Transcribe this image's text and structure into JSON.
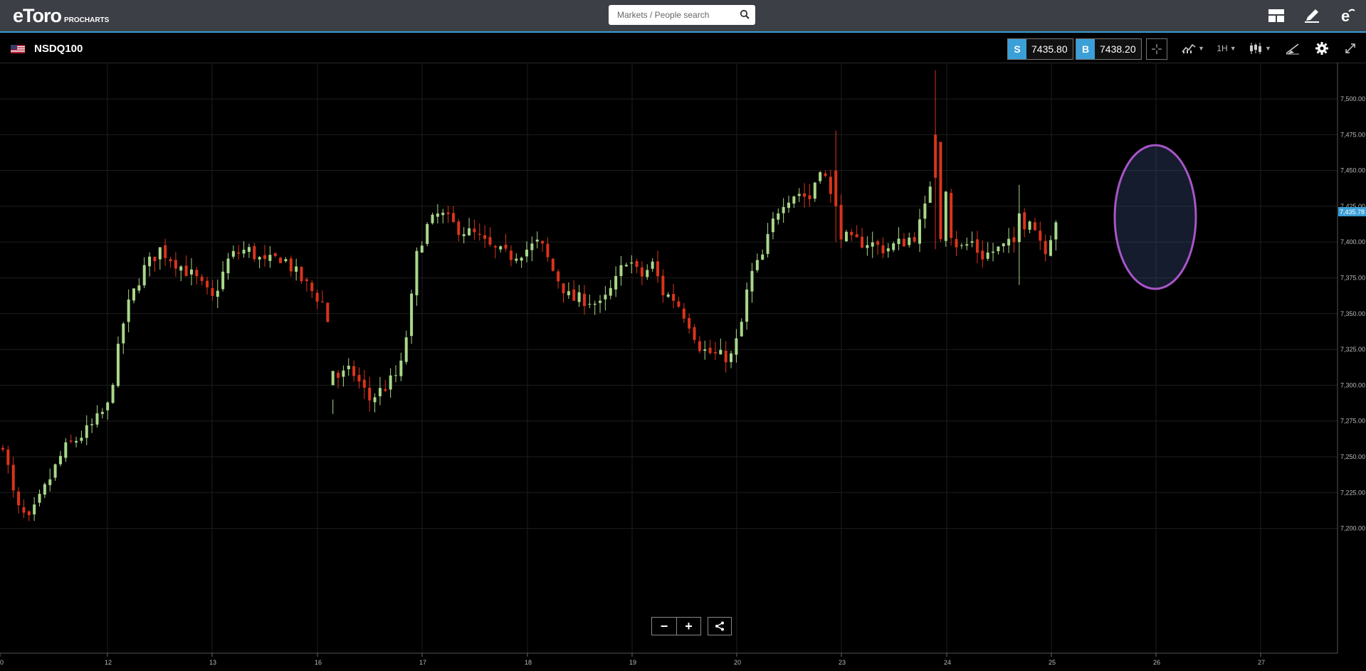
{
  "header": {
    "logo_text": "eToro",
    "logo_sub": "PROCHARTS",
    "search_placeholder": "Markets / People search",
    "icons": [
      "layout-icon",
      "pencil-icon",
      "etoro-e-icon"
    ]
  },
  "instrument": {
    "name": "NSDQ100",
    "sell_label": "S",
    "sell_price": "7435.80",
    "buy_label": "B",
    "buy_price": "7438.20",
    "timeframe": "1H",
    "current_price_label": "7,435.78"
  },
  "toolbar": {
    "icons": [
      "crosshair-icon",
      "indicators-icon",
      "candlestick-type-icon",
      "drawing-tool-icon",
      "settings-gear-icon",
      "fullscreen-icon"
    ]
  },
  "zoom": {
    "zoom_out": "−",
    "zoom_in": "+",
    "share_icon": "share-icon"
  },
  "colors": {
    "up": "#a8d88a",
    "down": "#d9341c",
    "accent": "#3b9fd8",
    "ellipse": "#a855c8"
  },
  "chart_data": {
    "type": "candlestick",
    "current_price": 7435.78,
    "y_ticks": [
      "7,500.00",
      "7,475.00",
      "7,450.00",
      "7,425.00",
      "7,400.00",
      "7,375.00",
      "7,350.00",
      "7,325.00",
      "7,300.00",
      "7,275.00",
      "7,250.00",
      "7,225.00",
      "7,200.00"
    ],
    "x_ticks": [
      "0",
      "12",
      "13",
      "16",
      "17",
      "18",
      "19",
      "20",
      "23",
      "24",
      "25",
      "26",
      "27"
    ],
    "ylim": [
      7185,
      7520
    ],
    "highlight_ellipse": "around spike on the 26th",
    "anchors": [
      [
        0,
        7260
      ],
      [
        1.5,
        7215
      ],
      [
        3,
        7205
      ],
      [
        7,
        7255
      ],
      [
        10,
        7270
      ],
      [
        12,
        7285
      ],
      [
        14,
        7350
      ],
      [
        16,
        7380
      ],
      [
        18,
        7395
      ],
      [
        22,
        7375
      ],
      [
        24,
        7360
      ],
      [
        26,
        7390
      ],
      [
        28,
        7395
      ],
      [
        30,
        7385
      ],
      [
        32,
        7390
      ],
      [
        34,
        7375
      ],
      [
        37,
        7355
      ],
      [
        38,
        7305
      ],
      [
        40,
        7310
      ],
      [
        42,
        7290
      ],
      [
        44,
        7300
      ],
      [
        45.5,
        7310
      ],
      [
        46.5,
        7345
      ],
      [
        47.5,
        7395
      ],
      [
        48.5,
        7410
      ],
      [
        50,
        7420
      ],
      [
        52,
        7410
      ],
      [
        54,
        7405
      ],
      [
        56,
        7395
      ],
      [
        58,
        7390
      ],
      [
        60,
        7395
      ],
      [
        61.5,
        7400
      ],
      [
        63,
        7380
      ],
      [
        65,
        7360
      ],
      [
        67,
        7360
      ],
      [
        68.5,
        7355
      ],
      [
        70,
        7370
      ],
      [
        71.5,
        7390
      ],
      [
        73,
        7375
      ],
      [
        74.5,
        7385
      ],
      [
        75.5,
        7365
      ],
      [
        77,
        7360
      ],
      [
        78.5,
        7345
      ],
      [
        80,
        7325
      ],
      [
        82,
        7320
      ],
      [
        83.5,
        7320
      ],
      [
        84.5,
        7340
      ],
      [
        85.5,
        7375
      ],
      [
        87,
        7390
      ],
      [
        88.5,
        7420
      ],
      [
        89.5,
        7430
      ],
      [
        91,
        7435
      ],
      [
        92.5,
        7430
      ],
      [
        93.5,
        7455
      ],
      [
        94.5,
        7440
      ],
      [
        95.5,
        7410
      ],
      [
        97,
        7400
      ],
      [
        99,
        7400
      ],
      [
        101,
        7395
      ],
      [
        103,
        7400
      ],
      [
        104.5,
        7405
      ],
      [
        105.5,
        7420
      ],
      [
        106.5,
        7450
      ],
      [
        107.5,
        7470
      ],
      [
        108.5,
        7408
      ],
      [
        109.5,
        7395
      ],
      [
        111,
        7400
      ],
      [
        112,
        7390
      ],
      [
        114,
        7395
      ],
      [
        116,
        7400
      ],
      [
        117.5,
        7420
      ],
      [
        118.5,
        7405
      ],
      [
        119.5,
        7395
      ],
      [
        120.5,
        7415
      ],
      [
        121.5,
        7425
      ],
      [
        122.5,
        7432
      ],
      [
        123.5,
        7436
      ]
    ]
  }
}
